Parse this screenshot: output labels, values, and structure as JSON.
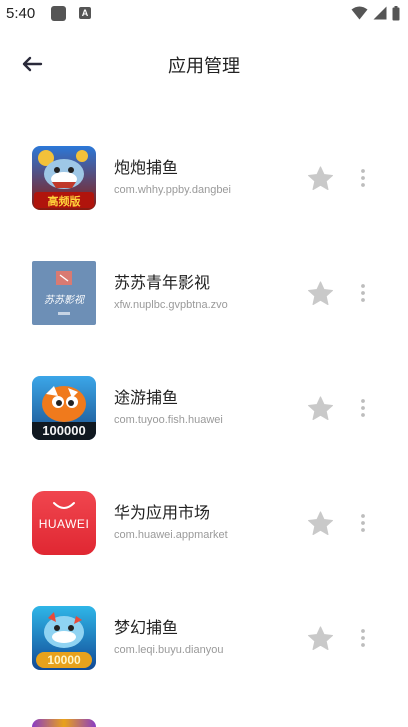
{
  "status_bar": {
    "time": "5:40",
    "notification_icons": [
      "square-notification-icon",
      "a-notification-icon"
    ],
    "a_icon_text": "A",
    "right_icons": [
      "wifi-icon",
      "signal-icon",
      "battery-icon"
    ]
  },
  "header": {
    "back_icon": "arrow-left-icon",
    "title": "应用管理"
  },
  "apps": [
    {
      "name": "炮炮捕鱼",
      "package": "com.whhy.ppby.dangbei",
      "icon_text": "高频版"
    },
    {
      "name": "苏苏青年影视",
      "package": "xfw.nuplbc.gvpbtna.zvo",
      "icon_text": "苏苏影视"
    },
    {
      "name": "途游捕鱼",
      "package": "com.tuyoo.fish.huawei",
      "icon_text": "100000"
    },
    {
      "name": "华为应用市场",
      "package": "com.huawei.appmarket",
      "icon_text": "HUAWEI"
    },
    {
      "name": "梦幻捕鱼",
      "package": "com.leqi.buyu.dianyou",
      "icon_text": "10000"
    }
  ],
  "colors": {
    "star": "#c9c9c9",
    "more": "#bdbdbd",
    "package_text": "#9a9a9a",
    "huawei_red": "#e8303a"
  }
}
